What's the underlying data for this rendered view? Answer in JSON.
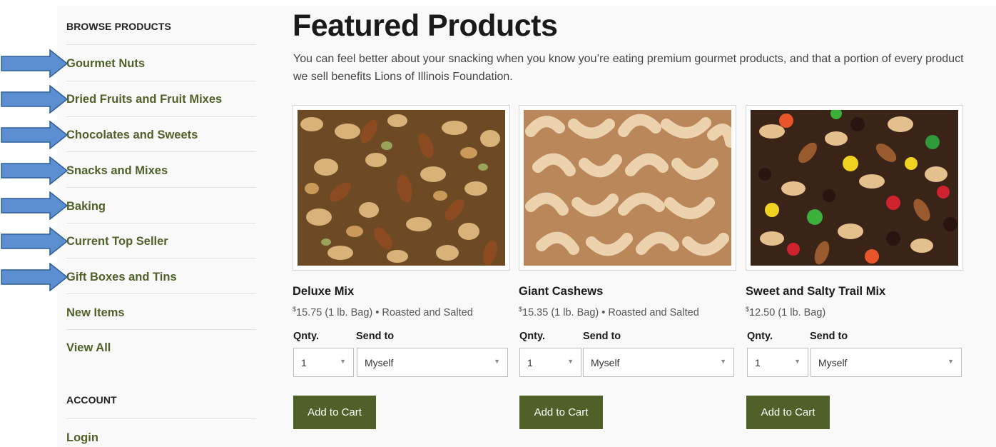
{
  "sidebar": {
    "browse_heading": "BROWSE PRODUCTS",
    "items": [
      {
        "label": "Gourmet Nuts"
      },
      {
        "label": "Dried Fruits and Fruit Mixes"
      },
      {
        "label": "Chocolates and Sweets"
      },
      {
        "label": "Snacks and Mixes"
      },
      {
        "label": "Baking"
      },
      {
        "label": "Current Top Seller"
      },
      {
        "label": "Gift Boxes and Tins"
      },
      {
        "label": "New Items"
      },
      {
        "label": "View All"
      }
    ],
    "account_heading": "ACCOUNT",
    "account_items": [
      {
        "label": "Login"
      }
    ]
  },
  "main": {
    "title": "Featured Products",
    "intro": "You can feel better about your snacking when you know you’re eating premium gourmet products, and that a portion of every product we sell benefits Lions of Illinois Foundation.",
    "qty_label": "Qnty.",
    "send_label": "Send to",
    "add_to_cart": "Add to Cart"
  },
  "products": [
    {
      "name": "Deluxe Mix",
      "currency": "$",
      "price": "15.75",
      "size": "(1 lb. Bag)",
      "note": " • Roasted and Salted",
      "qty": "1",
      "send_to": "Myself",
      "image_icon": "mixed-nuts-photo"
    },
    {
      "name": "Giant Cashews",
      "currency": "$",
      "price": "15.35",
      "size": "(1 lb. Bag)",
      "note": " • Roasted and Salted",
      "qty": "1",
      "send_to": "Myself",
      "image_icon": "cashews-photo"
    },
    {
      "name": "Sweet and Salty Trail Mix",
      "currency": "$",
      "price": "12.50",
      "size": "(1 lb. Bag)",
      "note": "",
      "qty": "1",
      "send_to": "Myself",
      "image_icon": "trail-mix-photo"
    }
  ],
  "colors": {
    "brand_green": "#4f6129",
    "arrow_fill": "#5b8fd1",
    "arrow_stroke": "#2f5e99"
  }
}
